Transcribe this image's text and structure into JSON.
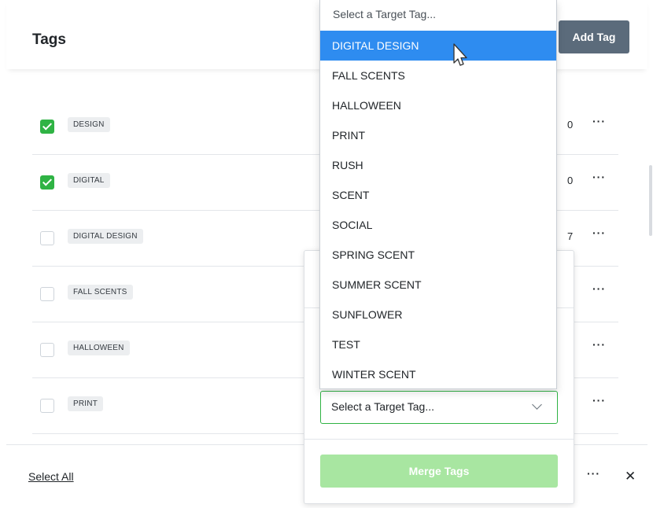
{
  "header": {
    "title": "Tags",
    "add_tag_label": "Add Tag"
  },
  "rows": [
    {
      "tag": "DESIGN",
      "checked": true,
      "count": "0",
      "more": "···"
    },
    {
      "tag": "DIGITAL",
      "checked": true,
      "count": "0",
      "more": "···"
    },
    {
      "tag": "DIGITAL DESIGN",
      "checked": false,
      "count": "7",
      "more": "···"
    },
    {
      "tag": "FALL SCENTS",
      "checked": false,
      "count": "",
      "more": "···"
    },
    {
      "tag": "HALLOWEEN",
      "checked": false,
      "count": "",
      "more": "···"
    },
    {
      "tag": "PRINT",
      "checked": false,
      "count": "",
      "more": "···"
    }
  ],
  "footer": {
    "select_all": "Select All",
    "more": "···",
    "close": "✕"
  },
  "merge": {
    "target_select_value": "Select a Target Tag...",
    "merge_button": "Merge Tags"
  },
  "dropdown": {
    "placeholder": "Select a Target Tag...",
    "options": [
      "DIGITAL DESIGN",
      "FALL SCENTS",
      "HALLOWEEN",
      "PRINT",
      "RUSH",
      "SCENT",
      "SOCIAL",
      "SPRING SCENT",
      "SUMMER SCENT",
      "SUNFLOWER",
      "TEST",
      "WINTER SCENT"
    ],
    "highlighted": "DIGITAL DESIGN"
  },
  "colors": {
    "checkbox_checked": "#2fb344",
    "highlight": "#2e8cf0",
    "merge_button_disabled": "#a8e6a1",
    "add_tag_button": "#5b6b7b"
  },
  "icons": [
    "check-icon",
    "more-icon",
    "close-icon",
    "chevron-down-icon",
    "mouse-cursor-icon"
  ]
}
